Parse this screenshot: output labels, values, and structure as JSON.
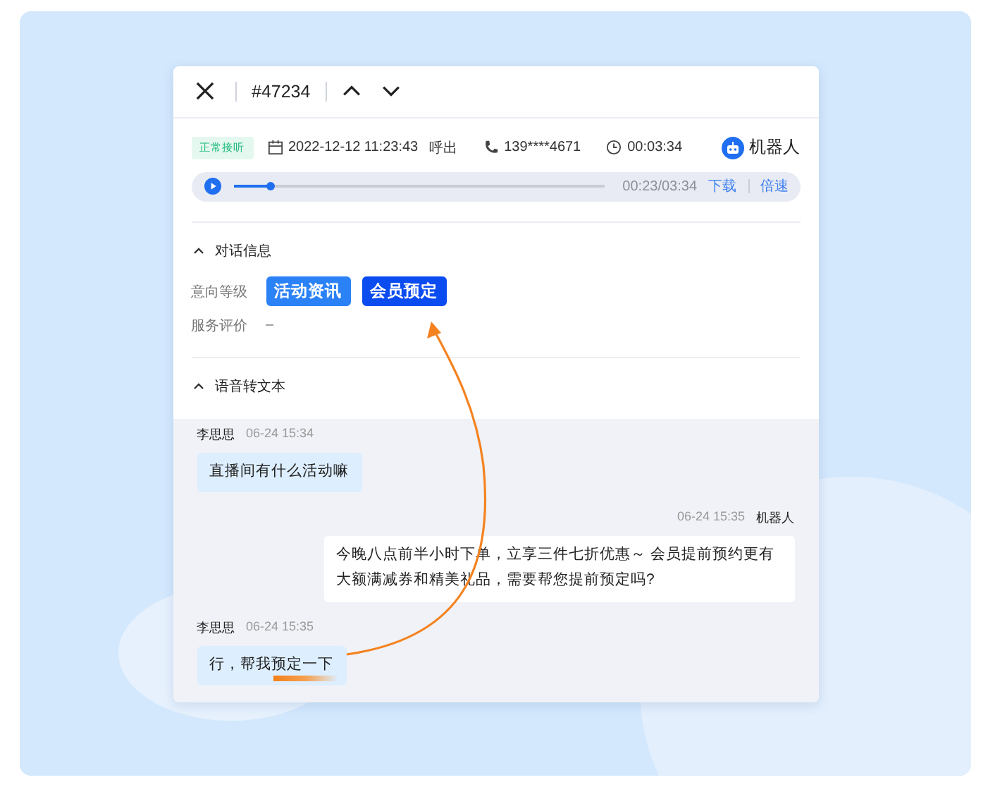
{
  "header": {
    "ticket": "#47234"
  },
  "call": {
    "status": "正常接听",
    "datetime": "2022-12-12 11:23:43",
    "direction": "呼出",
    "phone": "139****4671",
    "duration": "00:03:34",
    "agent": "机器人"
  },
  "player": {
    "level": 0.1,
    "time": "00:23/03:34",
    "actions": [
      "下载",
      "倍速"
    ]
  },
  "dialog_info": {
    "title": "对话信息",
    "expanded": true,
    "fields": [
      {
        "label": "意向等级",
        "kind": "tags",
        "tags": [
          {
            "label": "活动资讯",
            "selected": false
          },
          {
            "label": "会员预定",
            "selected": true
          }
        ]
      },
      {
        "label": "服务评价",
        "kind": "text",
        "value": "–"
      }
    ]
  },
  "transcript": {
    "title": "语音转文本",
    "expanded": true,
    "messages": [
      {
        "kind": "user",
        "name": "李思思",
        "time": "06-24 15:34",
        "text": "直播间有什么活动嘛"
      },
      {
        "kind": "bot",
        "name": "机器人",
        "time": "06-24 15:35",
        "text": "今晚八点前半小时下单，立享三件七折优惠～ 会员提前预约更有大额满减券和精美礼品，需要帮您提前预定吗?"
      },
      {
        "kind": "user",
        "name": "李思思",
        "time": "06-24 15:35",
        "text": "行，帮我预定一下"
      }
    ]
  }
}
